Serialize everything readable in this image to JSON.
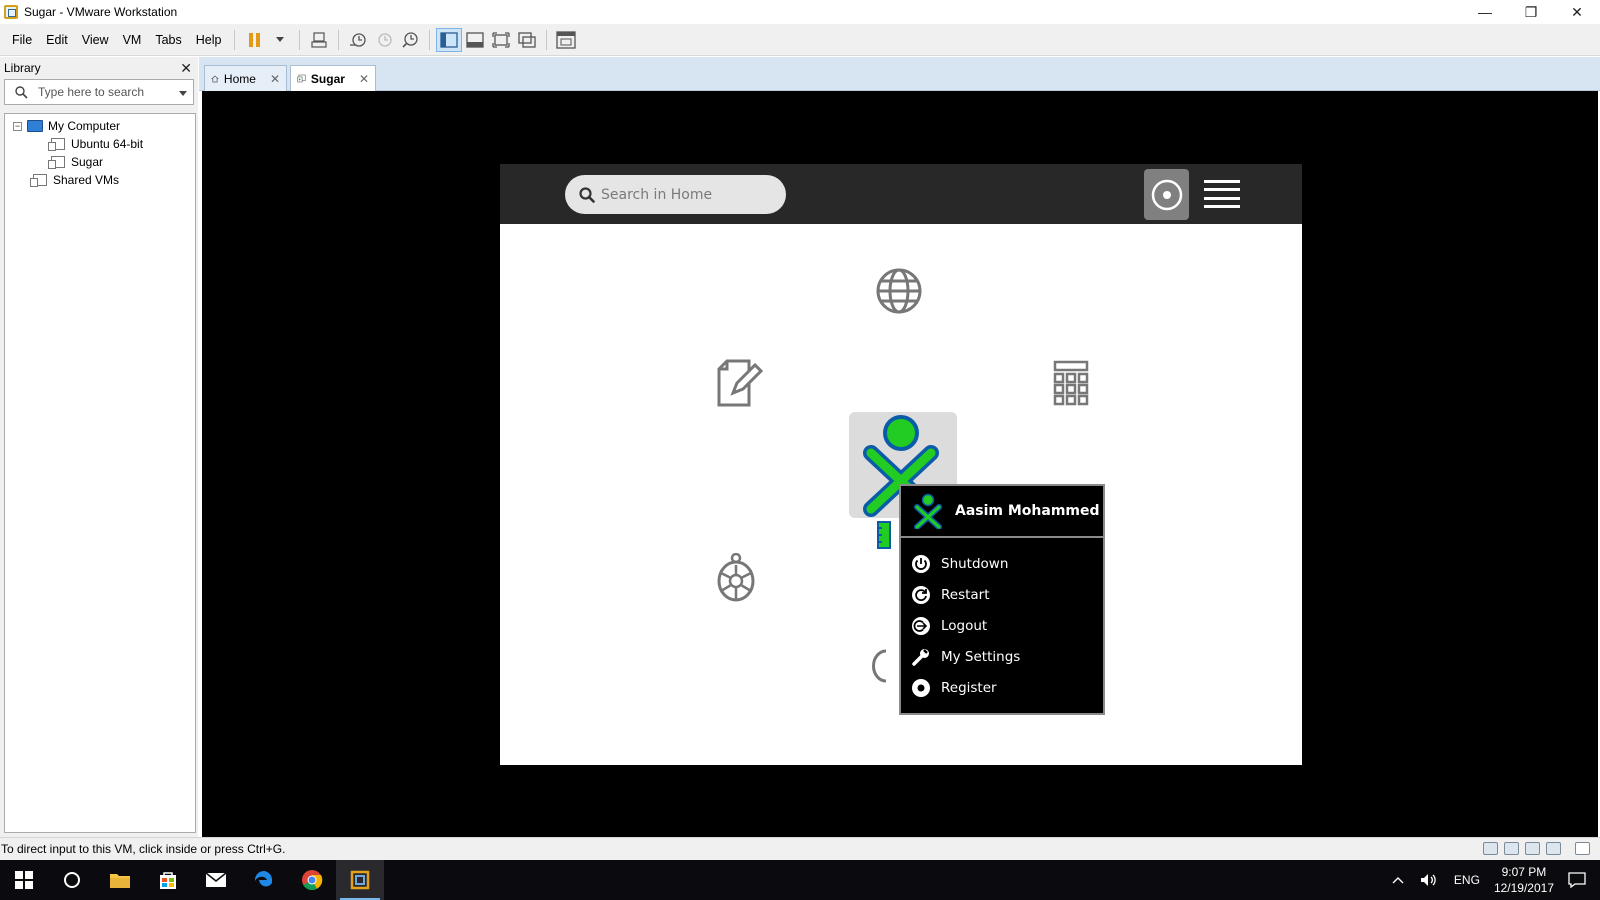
{
  "window": {
    "title": "Sugar - VMware Workstation",
    "minimize": "—",
    "restore": "❐",
    "close": "✕"
  },
  "menu": [
    "File",
    "Edit",
    "View",
    "VM",
    "Tabs",
    "Help"
  ],
  "library": {
    "title": "Library",
    "close": "✕",
    "search_placeholder": "Type here to search",
    "tree": {
      "toggle": "−",
      "root": "My Computer",
      "vms": [
        "Ubuntu 64-bit",
        "Sugar"
      ],
      "shared": "Shared VMs"
    }
  },
  "tabs": [
    {
      "label": "Home",
      "close": "✕"
    },
    {
      "label": "Sugar",
      "close": "✕"
    }
  ],
  "sugar": {
    "search_placeholder": "Search in Home",
    "user_name": "Aasim Mohammed",
    "palette_items": [
      "Shutdown",
      "Restart",
      "Logout",
      "My Settings",
      "Register"
    ],
    "xo_stroke": "#0a5ca8",
    "xo_fill": "#22cc22"
  },
  "statusbar": {
    "message": "To direct input to this VM, click inside or press Ctrl+G."
  },
  "taskbar": {
    "language": "ENG",
    "time": "9:07 PM",
    "date": "12/19/2017"
  },
  "colors": {
    "tab_bar": "#d7e4f2",
    "sugar_toolbar": "#282828",
    "palette_bg": "#000000"
  }
}
